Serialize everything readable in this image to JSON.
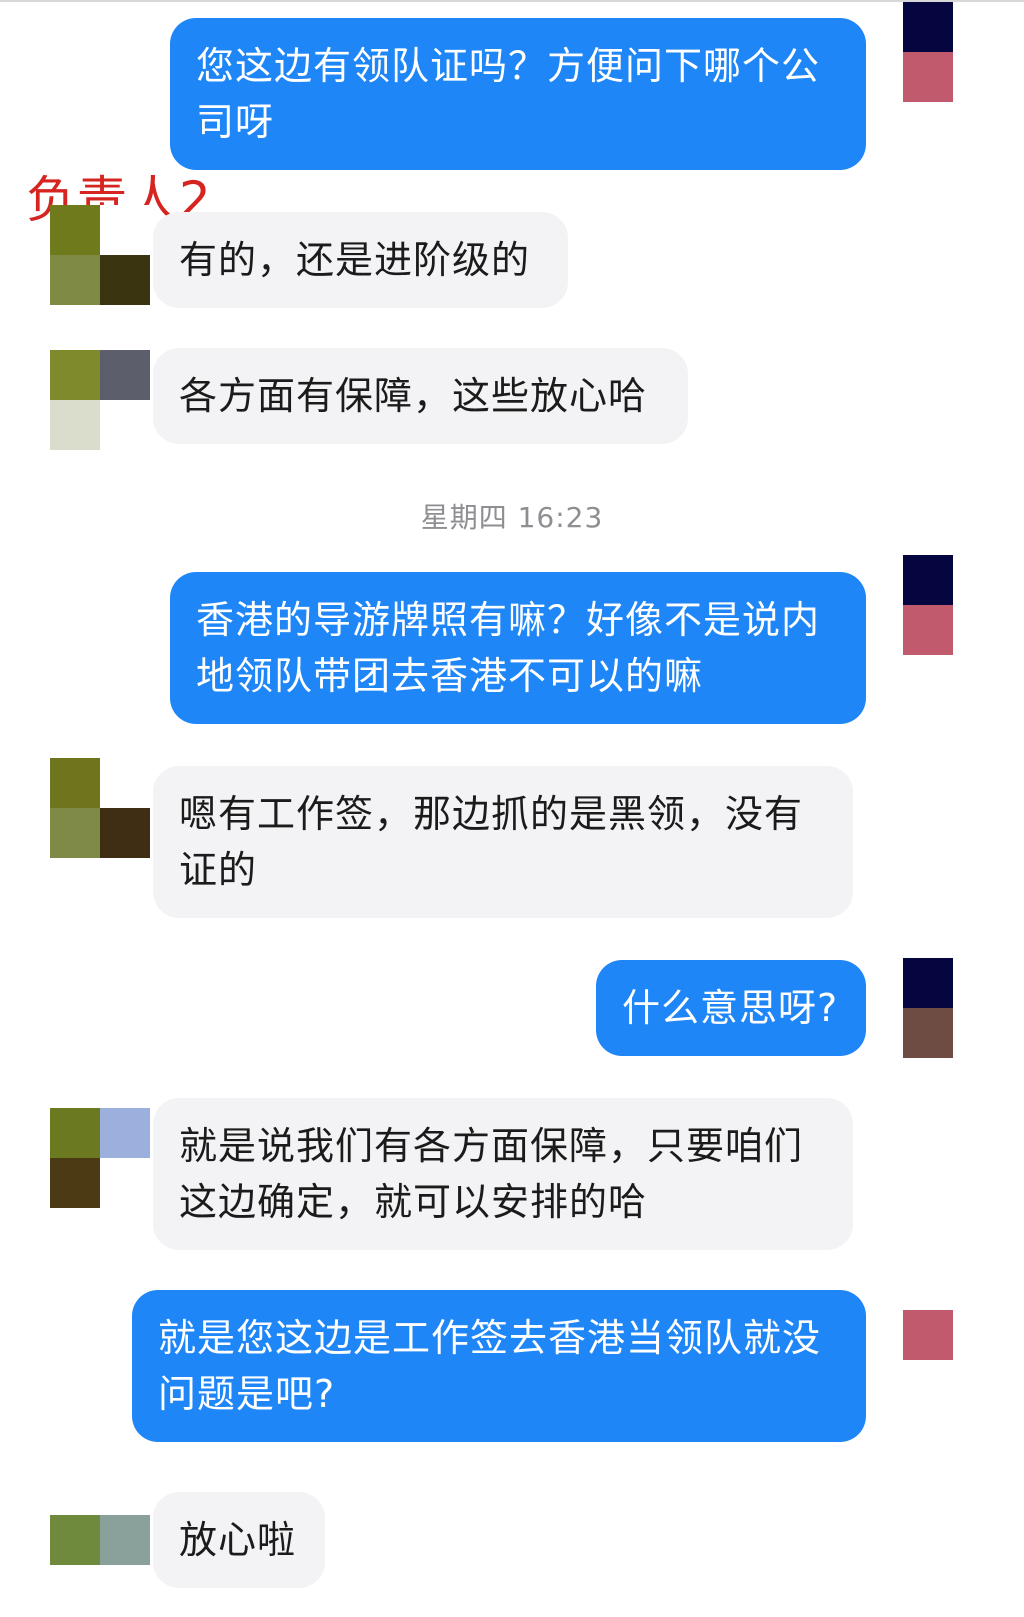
{
  "annotation": "负责人2",
  "timestamp": "星期四 16:23",
  "messages": [
    {
      "text": "您这边有领队证吗？方便问下哪个公司呀"
    },
    {
      "text": "有的，还是进阶级的"
    },
    {
      "text": "各方面有保障，这些放心哈"
    },
    {
      "text": "香港的导游牌照有嘛？好像不是说内地领队带团去香港不可以的嘛"
    },
    {
      "text": "嗯有工作签，那边抓的是黑领，没有证的"
    },
    {
      "text": "什么意思呀?"
    },
    {
      "text": "就是说我们有各方面保障，只要咱们这边确定，就可以安排的哈"
    },
    {
      "text": "就是您这边是工作签去香港当领队就没问题是吧?"
    },
    {
      "text": "放心啦"
    }
  ],
  "colors": {
    "outgoing_bubble": "#1f86f7",
    "incoming_bubble": "#f3f3f5",
    "annotation": "#d62420"
  }
}
